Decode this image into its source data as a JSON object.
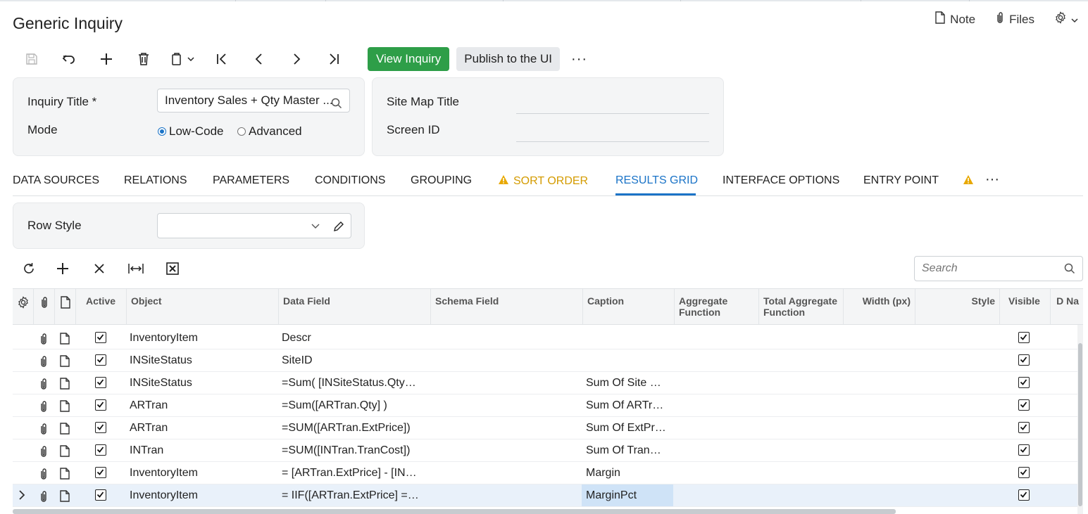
{
  "page": {
    "title": "Generic Inquiry"
  },
  "header_links": {
    "note": "Note",
    "files": "Files"
  },
  "toolbar": {
    "icons": [
      "save-icon",
      "undo-icon",
      "add-icon",
      "delete-icon",
      "copy-paste-icon",
      "first-icon",
      "previous-icon",
      "next-icon",
      "last-icon"
    ],
    "view_inquiry": "View Inquiry",
    "publish": "Publish to the UI",
    "more": "···"
  },
  "form": {
    "inquiry_title_label": "Inquiry Title *",
    "inquiry_title_value": "Inventory Sales + Qty Master ...",
    "mode_label": "Mode",
    "mode_options": [
      "Low-Code",
      "Advanced"
    ],
    "mode_selected": "Low-Code",
    "site_map_title_label": "Site Map Title",
    "site_map_title_value": "",
    "screen_id_label": "Screen ID",
    "screen_id_value": ""
  },
  "tabs": [
    {
      "label": "DATA SOURCES"
    },
    {
      "label": "RELATIONS"
    },
    {
      "label": "PARAMETERS"
    },
    {
      "label": "CONDITIONS"
    },
    {
      "label": "GROUPING"
    },
    {
      "label": "SORT ORDER",
      "warning": true
    },
    {
      "label": "RESULTS GRID",
      "active": true
    },
    {
      "label": "INTERFACE OPTIONS"
    },
    {
      "label": "ENTRY POINT"
    }
  ],
  "row_style": {
    "label": "Row Style",
    "value": ""
  },
  "grid_toolbar": {
    "icons": [
      "refresh-icon",
      "add-row-icon",
      "delete-row-icon",
      "fit-columns-icon",
      "excel-export-icon"
    ]
  },
  "search": {
    "placeholder": "Search"
  },
  "colors": {
    "primary_green": "#2e9e48",
    "accent_blue": "#1a73c7",
    "warning": "#d49b00"
  },
  "grid": {
    "columns": [
      "Active",
      "Object",
      "Data Field",
      "Schema Field",
      "Caption",
      "Aggregate Function",
      "Total Aggregate Function",
      "Width (px)",
      "Style",
      "Visible",
      "D Na"
    ],
    "rows": [
      {
        "object": "InventoryItem",
        "data_field": "Descr",
        "schema_field": "",
        "caption": "",
        "visible": true,
        "active": true
      },
      {
        "object": "INSiteStatus",
        "data_field": "SiteID",
        "schema_field": "",
        "caption": "",
        "visible": true,
        "active": true
      },
      {
        "object": "INSiteStatus",
        "data_field": "=Sum( [INSiteStatus.Qty…",
        "schema_field": "",
        "caption": "Sum Of Site …",
        "visible": true,
        "active": true
      },
      {
        "object": "ARTran",
        "data_field": "=Sum([ARTran.Qty] )",
        "schema_field": "",
        "caption": "Sum Of ARTr…",
        "visible": true,
        "active": true
      },
      {
        "object": "ARTran",
        "data_field": "=SUM([ARTran.ExtPrice])",
        "schema_field": "",
        "caption": "Sum Of ExtPr…",
        "visible": true,
        "active": true
      },
      {
        "object": "INTran",
        "data_field": "=SUM([INTran.TranCost])",
        "schema_field": "",
        "caption": "Sum Of Tran…",
        "visible": true,
        "active": true
      },
      {
        "object": "InventoryItem",
        "data_field": "= [ARTran.ExtPrice] - [IN…",
        "schema_field": "",
        "caption": "Margin",
        "visible": true,
        "active": true
      },
      {
        "object": "InventoryItem",
        "data_field": "= IIF([ARTran.ExtPrice] =…",
        "schema_field": "",
        "caption": "MarginPct",
        "visible": true,
        "active": true,
        "selected": true
      }
    ]
  }
}
